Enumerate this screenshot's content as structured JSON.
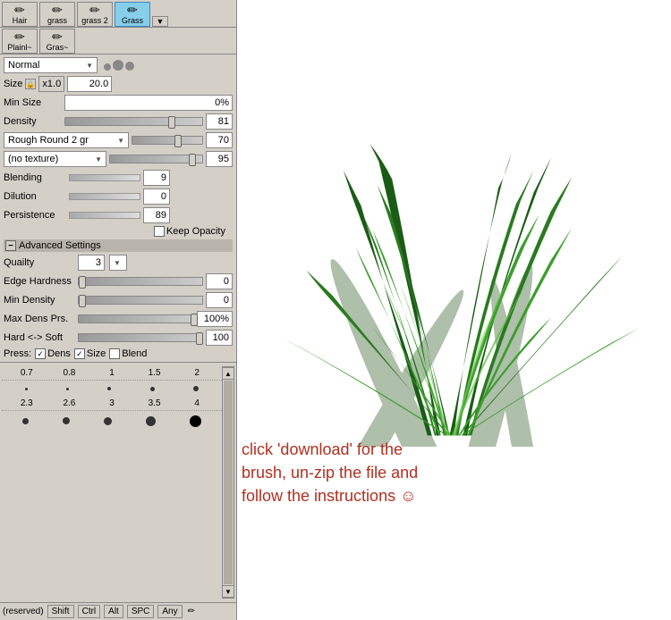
{
  "tabs": [
    {
      "label": "Hair",
      "icon": "✏",
      "active": false
    },
    {
      "label": "grass",
      "icon": "✏",
      "active": false
    },
    {
      "label": "grass 2",
      "icon": "✏",
      "active": false
    },
    {
      "label": "Grass",
      "icon": "✏",
      "active": true
    }
  ],
  "tabs2": [
    {
      "label": "Plainl~",
      "icon": "✏",
      "active": false
    },
    {
      "label": "Gras~",
      "icon": "✏",
      "active": false
    }
  ],
  "blendMode": {
    "label": "Normal",
    "value": "Normal"
  },
  "sizeRow": {
    "multiplier": "x1.0",
    "value": "20.0"
  },
  "minSize": {
    "label": "Min Size",
    "value": "0%"
  },
  "density": {
    "label": "Density",
    "value": "81"
  },
  "brushType": {
    "label": "Rough Round 2 gr",
    "value": "70"
  },
  "texture": {
    "label": "(no texture)",
    "value": "95"
  },
  "blending": {
    "label": "Blending",
    "value": "9"
  },
  "dilution": {
    "label": "Dilution",
    "value": "0"
  },
  "persistence": {
    "label": "Persistence",
    "value": "89"
  },
  "keepOpacity": {
    "label": "Keep Opacity",
    "checked": false
  },
  "advancedSettings": {
    "label": "Advanced Settings"
  },
  "quality": {
    "label": "Quailty",
    "value": "3"
  },
  "edgeHardness": {
    "label": "Edge Hardness",
    "value": "0"
  },
  "minDensity": {
    "label": "Min Density",
    "value": "0"
  },
  "maxDensPrs": {
    "label": "Max Dens Prs.",
    "value": "100%"
  },
  "hardSoft": {
    "label": "Hard <-> Soft",
    "value": "100"
  },
  "pressRow": {
    "press": "Press:",
    "dens": "Dens",
    "size": "Size",
    "blend": "Blend"
  },
  "dotRows": [
    {
      "cells": [
        {
          "label": "0.7",
          "dotSize": 3
        },
        {
          "label": "0.8",
          "dotSize": 3
        },
        {
          "label": "1",
          "dotSize": 4
        },
        {
          "label": "1.5",
          "dotSize": 5
        },
        {
          "label": "2",
          "dotSize": 6
        }
      ]
    },
    {
      "cells": [
        {
          "label": "·",
          "dotSize": 2
        },
        {
          "label": "·",
          "dotSize": 2
        },
        {
          "label": "·",
          "dotSize": 3
        },
        {
          "label": "·",
          "dotSize": 4
        },
        {
          "label": "·",
          "dotSize": 5
        }
      ]
    },
    {
      "cells": [
        {
          "label": "2.3",
          "dotSize": 7
        },
        {
          "label": "2.6",
          "dotSize": 8
        },
        {
          "label": "3",
          "dotSize": 9
        },
        {
          "label": "3.5",
          "dotSize": 11
        },
        {
          "label": "4",
          "dotSize": 13
        }
      ]
    },
    {
      "cells": [
        {
          "label": "·",
          "dotSize": 5
        },
        {
          "label": "·",
          "dotSize": 6
        },
        {
          "label": "·",
          "dotSize": 7
        },
        {
          "label": "·",
          "dotSize": 9
        },
        {
          "label": "●",
          "dotSize": 12
        }
      ]
    }
  ],
  "statusBar": {
    "reserved": "(reserved)",
    "shift": "Shift",
    "ctrl": "Ctrl",
    "alt": "Alt",
    "spc": "SPC",
    "any": "Any",
    "editIcon": "✏"
  },
  "instruction": "click 'download' for the\nbrush, un-zip the file and\nfollow the instructions ☺"
}
